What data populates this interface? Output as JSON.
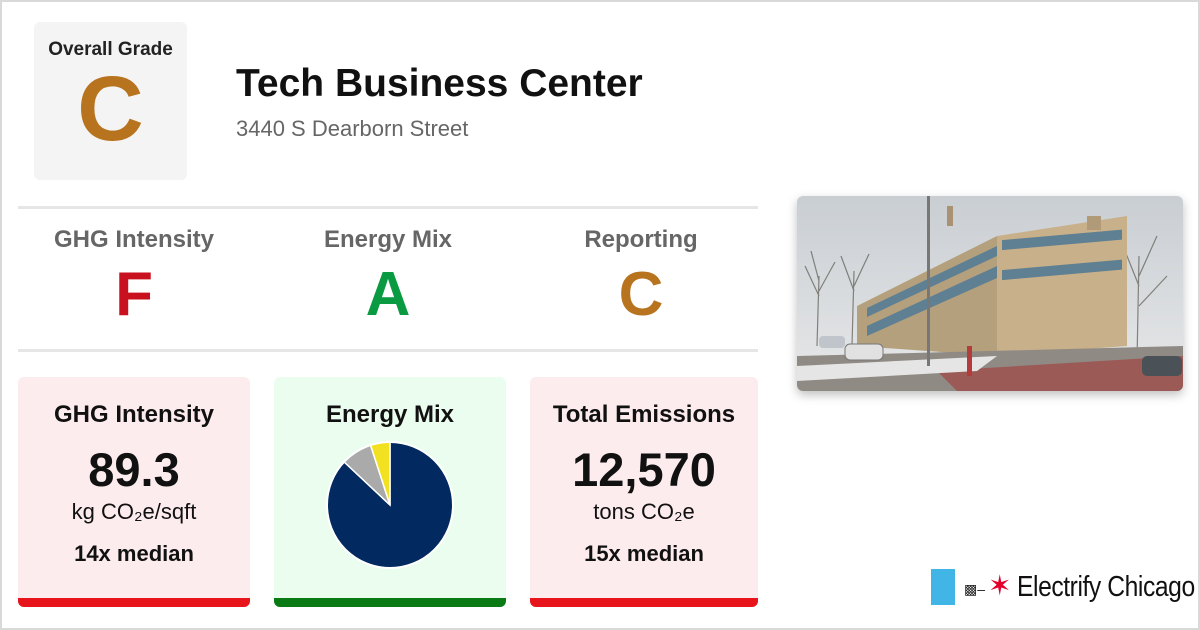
{
  "overall": {
    "label": "Overall Grade",
    "grade": "C",
    "color": "#b8731f"
  },
  "building": {
    "name": "Tech Business Center",
    "address": "3440 S Dearborn Street"
  },
  "subgrades": [
    {
      "label": "GHG Intensity",
      "grade": "F",
      "color": "#c8101e"
    },
    {
      "label": "Energy Mix",
      "grade": "A",
      "color": "#0a9a42"
    },
    {
      "label": "Reporting",
      "grade": "C",
      "color": "#b8731f"
    }
  ],
  "cards": {
    "ghg": {
      "title": "GHG Intensity",
      "value": "89.3",
      "unit": "kg CO₂e/sqft",
      "median": "14x median",
      "bar_color": "#e8141c"
    },
    "mix": {
      "title": "Energy Mix",
      "bar_color": "#0a7a14"
    },
    "emissions": {
      "title": "Total Emissions",
      "value": "12,570",
      "unit": "tons CO₂e",
      "median": "15x median",
      "bar_color": "#e8141c"
    }
  },
  "chart_data": {
    "type": "pie",
    "slices": [
      {
        "value": 0.87,
        "color": "#032a60"
      },
      {
        "value": 0.08,
        "color": "#aaaaaa"
      },
      {
        "value": 0.05,
        "color": "#f2e120"
      }
    ]
  },
  "logo": {
    "text": "Electrify Chicago",
    "icons": [
      "plug-icon",
      "chicago-star-icon"
    ]
  }
}
